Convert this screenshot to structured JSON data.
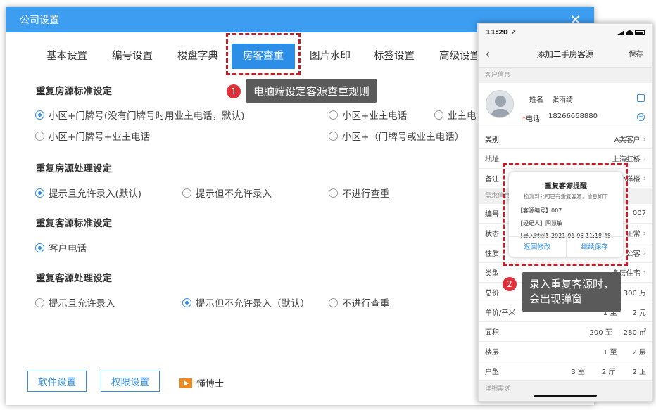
{
  "dialog": {
    "title": "公司设置",
    "close": "✕",
    "tabs": [
      "基本设置",
      "编号设置",
      "楼盘字典",
      "房客查重",
      "图片水印",
      "标签设置",
      "高级设置"
    ],
    "active_tab": "房客查重",
    "sections": {
      "house_std": {
        "title": "重复房源标准设定",
        "options": [
          "小区+门牌号(没有门牌号时用业主电话，默认)",
          "小区+业主电话",
          "业主电",
          "小区+门牌号+业主电话",
          "小区+（门牌号或业主电话）"
        ]
      },
      "house_proc": {
        "title": "重复房源处理设定",
        "options": [
          "提示且允许录入(默认)",
          "提示但不允许录入",
          "不进行查重"
        ]
      },
      "cust_std": {
        "title": "重复客源标准设定",
        "options": [
          "客户电话"
        ]
      },
      "cust_proc": {
        "title": "重复客源处理设定",
        "options": [
          "提示且允许录入",
          "提示但不允许录入（默认）",
          "不进行查重"
        ]
      }
    },
    "footer": {
      "software_btn": "软件设置",
      "perm_btn": "权限设置",
      "doc_link": "懂博士"
    }
  },
  "callouts": {
    "c1_num": "1",
    "c1_text": "电脑端设定客源查重规则",
    "c2_num": "2",
    "c2_line1": "录入重复客源时，",
    "c2_line2": "会出现弹窗"
  },
  "phone": {
    "time": "11:20 ➚",
    "nav_title": "添加二手房客源",
    "nav_save": "保存",
    "group_customer": "客户信息",
    "name_label": "姓名",
    "name_value": "张雨绮",
    "phone_label": "电话",
    "phone_value": "18266668880",
    "rows_top": [
      {
        "label": "类别",
        "value": "A类客户"
      },
      {
        "label": "地址",
        "value": "上海虹桥"
      },
      {
        "label": "备注",
        "value": "小洋楼"
      }
    ],
    "group_need": "需求信息",
    "rows_mid": [
      {
        "label": "编号",
        "value": "007"
      },
      {
        "label": "状态",
        "value": "正常"
      },
      {
        "label": "性质",
        "value": "公客"
      },
      {
        "label": "类型",
        "value": "多层住宅"
      },
      {
        "label": "总价",
        "value": "300 万"
      }
    ],
    "unit_price": {
      "label": "单价/平米",
      "from": "1 至",
      "to": "2 元"
    },
    "area": {
      "label": "面积",
      "from": "200 至",
      "to": "280 ㎡"
    },
    "floor": {
      "label": "楼层",
      "from": "1 至",
      "to": "2 层"
    },
    "layout": {
      "label": "户型",
      "a": "3 室",
      "b": "2 厅",
      "c": "2 卫"
    },
    "group_detail": "详细需求",
    "popup": {
      "title": "重复客源提醒",
      "subtitle": "检测到公司已有重复客源，信息如下",
      "line1": "【客源编号】007",
      "line2": "【经纪人】阴慧敏",
      "line3": "【录入时间】2021-01-05 11:18:48",
      "btn_back": "返回修改",
      "btn_continue": "继续保存"
    }
  }
}
